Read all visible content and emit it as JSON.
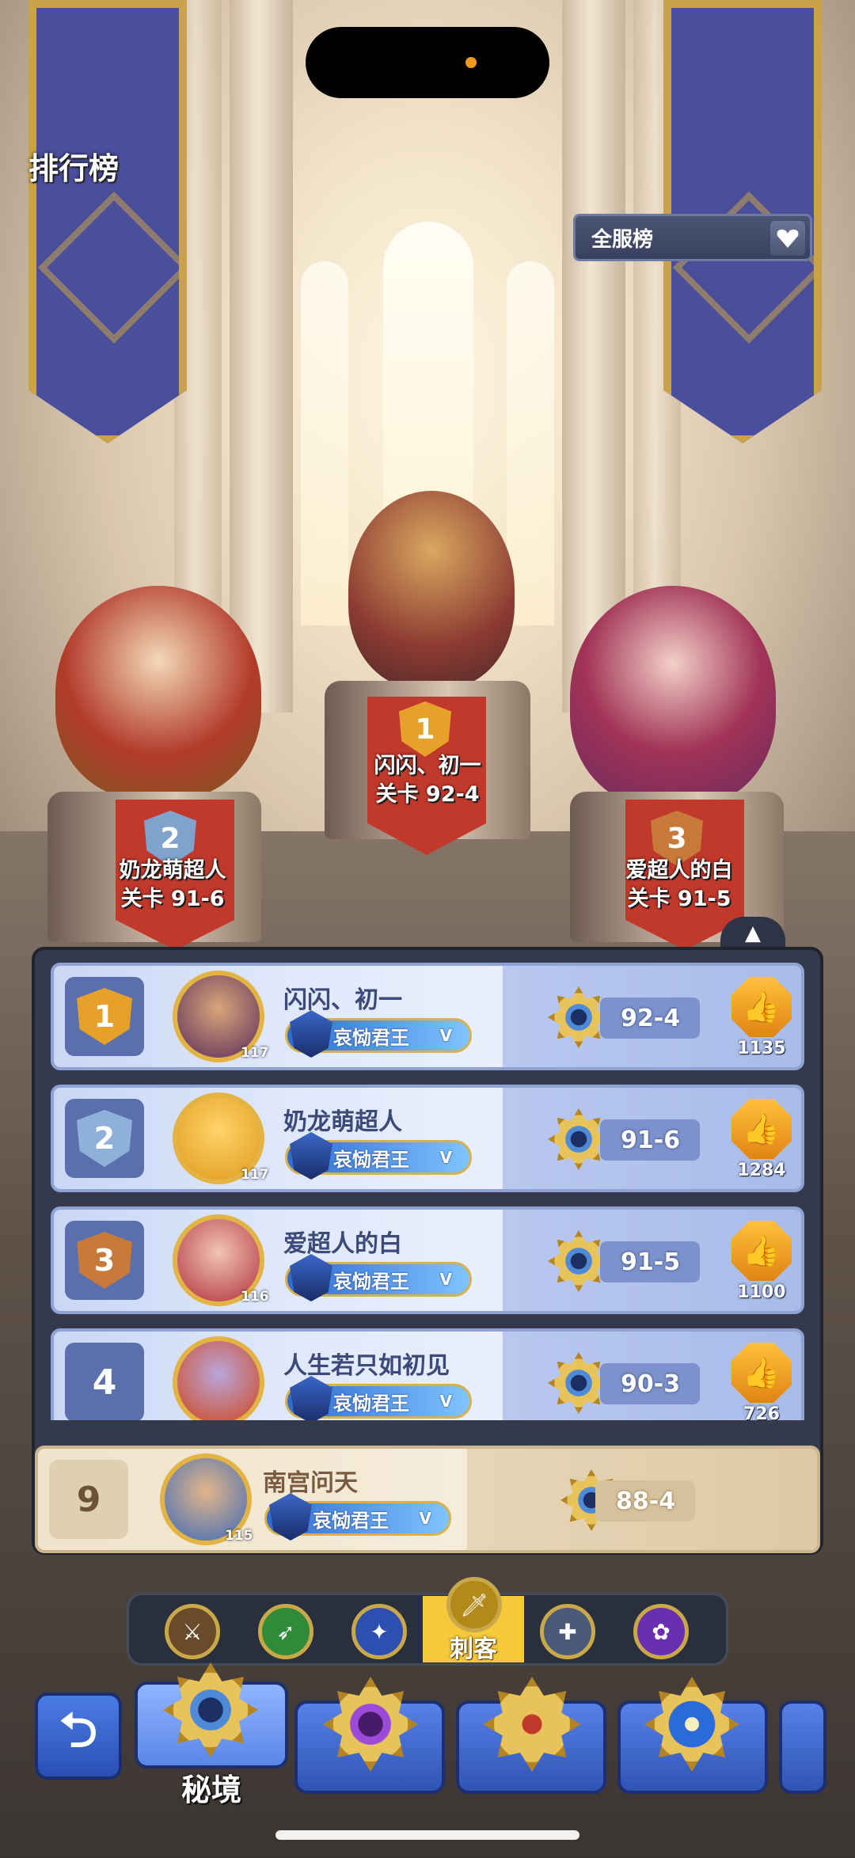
{
  "page": {
    "title": "排行榜"
  },
  "server_filter": {
    "selected": "全服榜",
    "icon": "heart-chevron-icon"
  },
  "podium": [
    {
      "rank": "1",
      "name": "闪闪、初一",
      "stage": "关卡 92-4",
      "color": "#e6a12a"
    },
    {
      "rank": "2",
      "name": "奶龙萌超人",
      "stage": "关卡 91-6",
      "color": "#7fa3cc"
    },
    {
      "rank": "3",
      "name": "爱超人的白",
      "stage": "关卡 91-5",
      "color": "#c77a3a"
    }
  ],
  "list": [
    {
      "rank": "1",
      "name": "闪闪、初一",
      "level": "117",
      "title": "哀恸君王",
      "title_tier": "V",
      "stage": "92-4",
      "likes": "1135",
      "badge_color": "#e6a12a"
    },
    {
      "rank": "2",
      "name": "奶龙萌超人",
      "level": "117",
      "title": "哀恸君王",
      "title_tier": "V",
      "stage": "91-6",
      "likes": "1284",
      "badge_color": "#8fb0d8"
    },
    {
      "rank": "3",
      "name": "爱超人的白",
      "level": "116",
      "title": "哀恸君王",
      "title_tier": "V",
      "stage": "91-5",
      "likes": "1100",
      "badge_color": "#c77a3a"
    },
    {
      "rank": "4",
      "name": "人生若只如初见",
      "level": "",
      "title": "哀恸君王",
      "title_tier": "V",
      "stage": "90-3",
      "likes": "726",
      "badge_color": ""
    }
  ],
  "self": {
    "rank": "9",
    "name": "南宫问天",
    "level": "115",
    "title": "哀恸君王",
    "title_tier": "V",
    "stage": "88-4"
  },
  "class_tabs": {
    "items": [
      "warrior-icon",
      "archer-icon",
      "mage-icon",
      "assassin-icon",
      "priest-icon",
      "summoner-icon"
    ],
    "active_label": "刺客"
  },
  "bottom_nav": {
    "active_label": "秘境"
  },
  "colors": {
    "accent": "#f5c93a",
    "row": "#dfe8fb",
    "self_row": "#f5ecda"
  }
}
